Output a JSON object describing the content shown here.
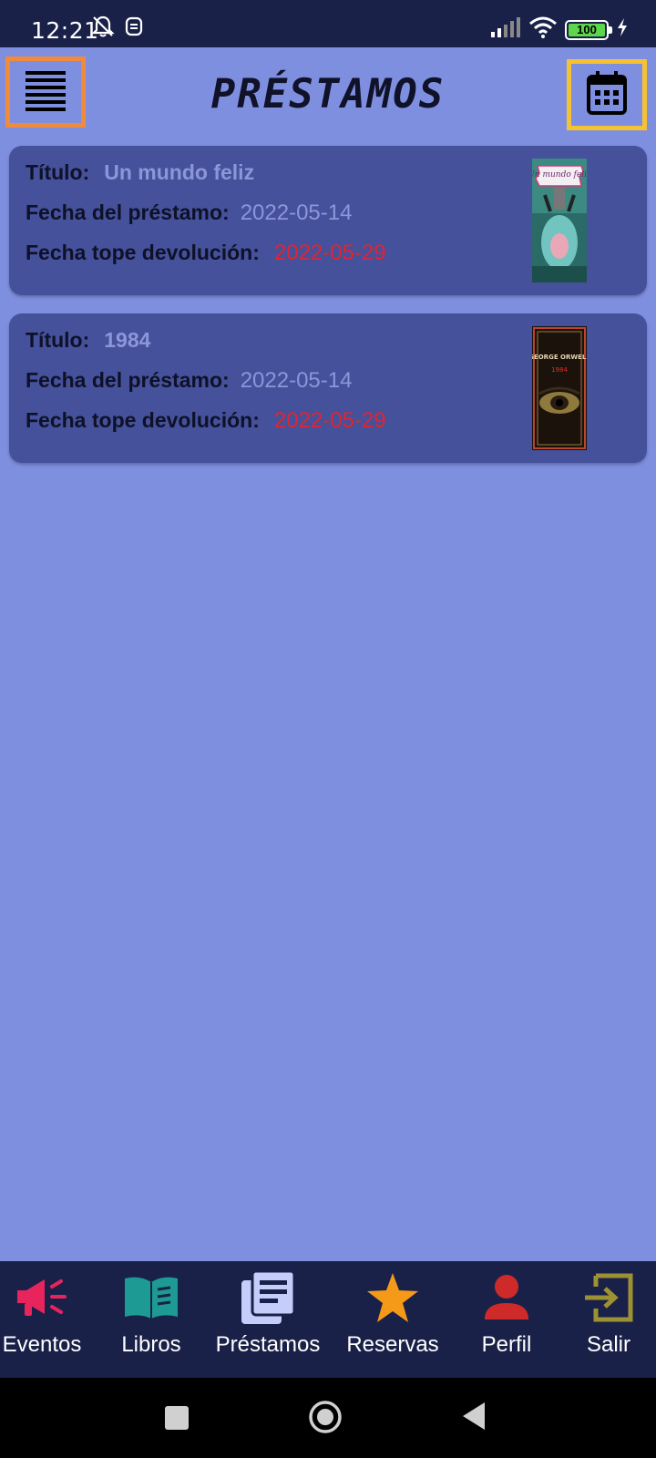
{
  "status_bar": {
    "time": "12:21",
    "battery": "100",
    "icons": [
      "bell-off-icon",
      "notification-icon",
      "signal-icon",
      "wifi-icon",
      "battery-icon",
      "charging-icon"
    ]
  },
  "header": {
    "title": "PRÉSTAMOS",
    "menu_icon": "menu-lines-icon",
    "calendar_icon": "calendar-icon",
    "menu_border_color": "#f08a3c",
    "calendar_border_color": "#f5c233"
  },
  "loans": [
    {
      "title_label": "Título:",
      "title": "Un mundo feliz",
      "loan_date_label": "Fecha del préstamo:",
      "loan_date": "2022-05-14",
      "due_date_label": "Fecha tope devolución:",
      "due_date": "2022-05-29",
      "cover_text": "Un mundo feliz"
    },
    {
      "title_label": "Título:",
      "title": "1984",
      "loan_date_label": "Fecha del préstamo:",
      "loan_date": "2022-05-14",
      "due_date_label": "Fecha tope devolución:",
      "due_date": "2022-05-29",
      "cover_author": "GEORGE ORWELL",
      "cover_title": "1984"
    }
  ],
  "bottom_nav": [
    {
      "label": "Eventos",
      "icon": "megaphone-icon",
      "color": "#e8245d"
    },
    {
      "label": "Libros",
      "icon": "book-icon",
      "color": "#1d9a94"
    },
    {
      "label": "Préstamos",
      "icon": "documents-icon",
      "color": "#c5cdfb"
    },
    {
      "label": "Reservas",
      "icon": "star-icon",
      "color": "#f59a18"
    },
    {
      "label": "Perfil",
      "icon": "person-icon",
      "color": "#cf2a2a"
    },
    {
      "label": "Salir",
      "icon": "exit-icon",
      "color": "#9c9234"
    }
  ],
  "colors": {
    "background": "#7f8fdf",
    "card": "#45519a",
    "nav_bar": "#1a2149",
    "due_date": "#e3232f",
    "secondary_text": "#8b97d9"
  }
}
